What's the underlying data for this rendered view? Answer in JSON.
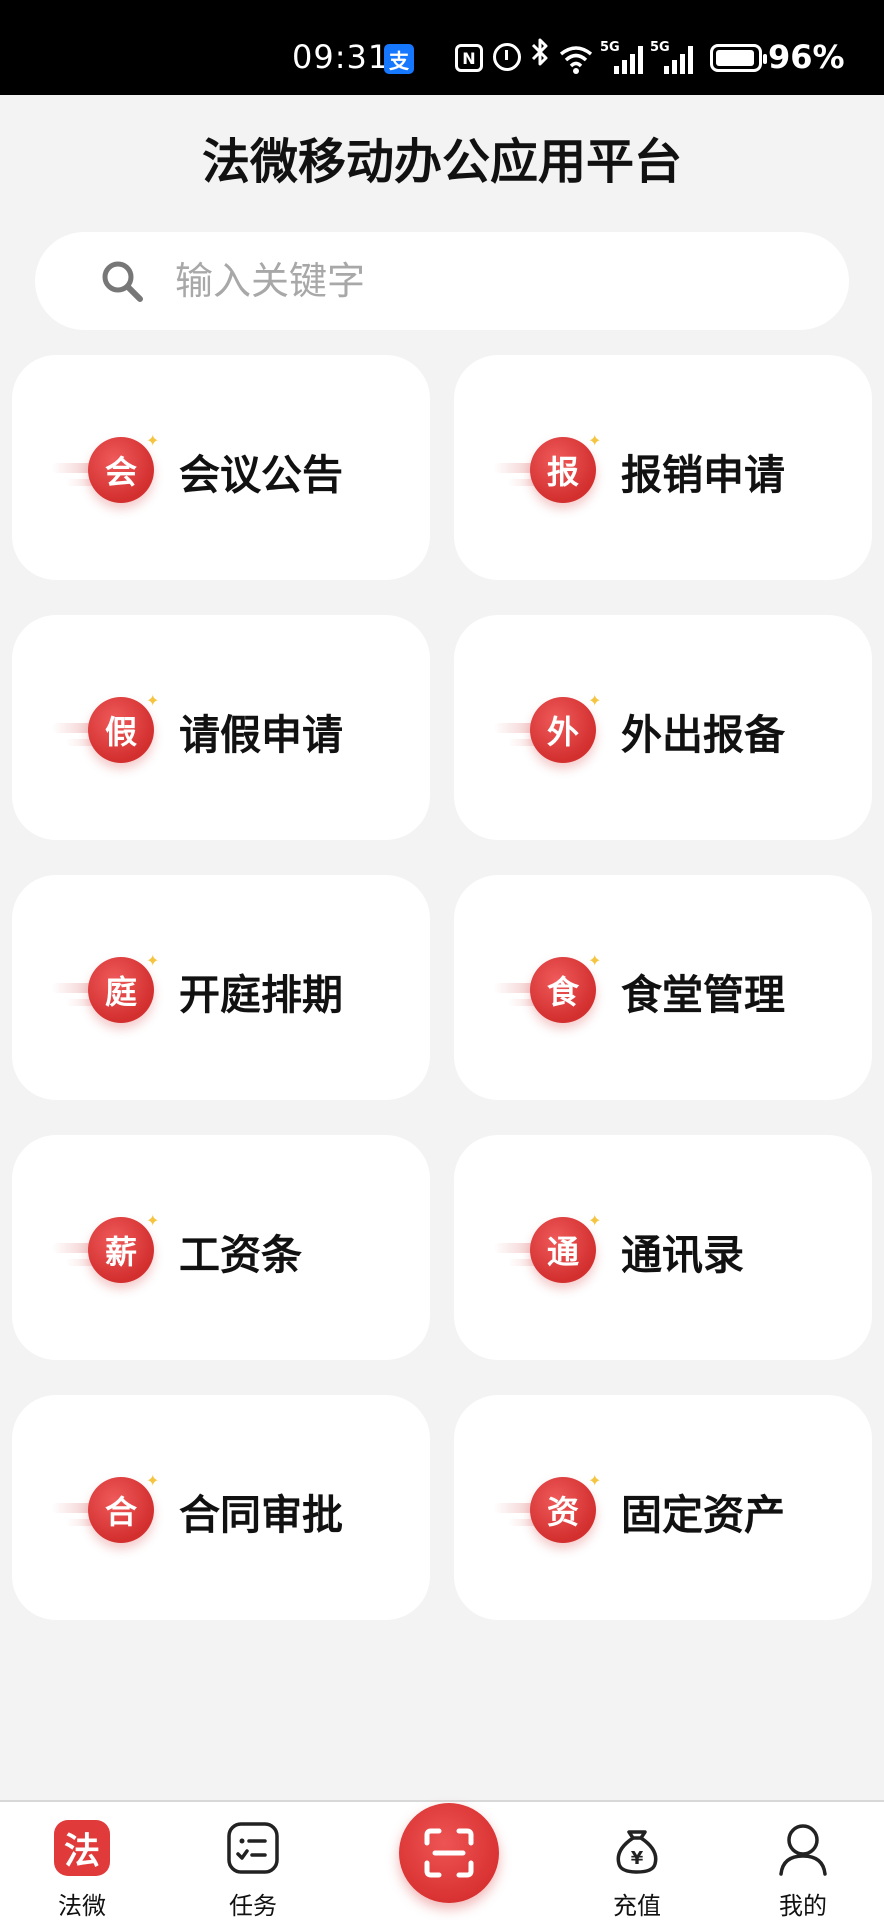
{
  "status_bar": {
    "time": "09:31",
    "alipay_glyph": "支",
    "nfc_glyph": "N",
    "bluetooth_glyph": "∦",
    "sig1_label": "5G",
    "sig2_label": "5G",
    "battery_pct": "96%"
  },
  "header": {
    "title": "法微移动办公应用平台"
  },
  "search": {
    "placeholder": "输入关键字",
    "value": ""
  },
  "apps": [
    {
      "glyph": "会",
      "label": "会议公告"
    },
    {
      "glyph": "报",
      "label": "报销申请"
    },
    {
      "glyph": "假",
      "label": "请假申请"
    },
    {
      "glyph": "外",
      "label": "外出报备"
    },
    {
      "glyph": "庭",
      "label": "开庭排期"
    },
    {
      "glyph": "食",
      "label": "食堂管理"
    },
    {
      "glyph": "薪",
      "label": "工资条"
    },
    {
      "glyph": "通",
      "label": "通讯录"
    },
    {
      "glyph": "合",
      "label": "合同审批"
    },
    {
      "glyph": "资",
      "label": "固定资产"
    }
  ],
  "bottom_nav": {
    "fawei": {
      "glyph": "法",
      "label": "法微"
    },
    "tasks": {
      "label": "任务"
    },
    "recharge": {
      "glyph": "¥",
      "label": "充值"
    },
    "mine": {
      "label": "我的"
    }
  },
  "colors": {
    "accent": "#d83030",
    "background": "#f3f3f3",
    "card": "#ffffff",
    "alipay": "#1677ff"
  }
}
